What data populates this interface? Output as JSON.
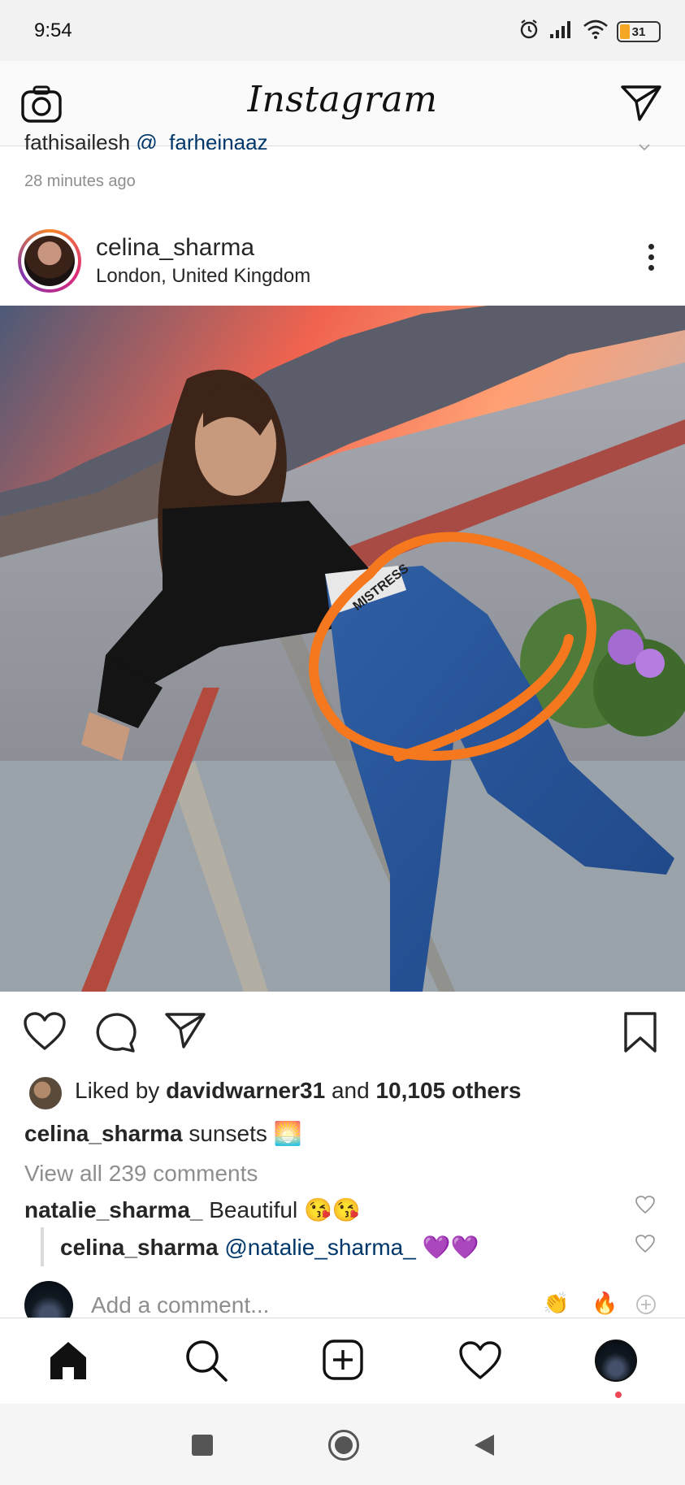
{
  "status_bar": {
    "time": "9:54",
    "battery": "31"
  },
  "header": {
    "logo": "Instagram",
    "camera_icon": "camera-icon",
    "direct_icon": "paper-plane-icon"
  },
  "previous": {
    "cutoff_user": "fathisailesh",
    "cutoff_mention": "@_farheinaaz_",
    "time_ago": "28 minutes ago"
  },
  "post": {
    "username": "celina_sharma",
    "location": "London, United Kingdom",
    "likes": {
      "prefix": "Liked by",
      "user": "davidwarner31",
      "conj": "and",
      "others": "10,105 others"
    },
    "caption": {
      "user": "celina_sharma",
      "text": "sunsets",
      "emoji": "🌅"
    },
    "view_all": "View all 239 comments",
    "comments": [
      {
        "user": "natalie_sharma_",
        "text": "Beautiful",
        "emoji": "😘😘"
      },
      {
        "user": "celina_sharma",
        "mention": "@natalie_sharma_",
        "emoji": "💜💜"
      }
    ],
    "photo_text": "MISTRESS"
  },
  "add_comment": {
    "placeholder": "Add a comment...",
    "quick_emojis": [
      "👏",
      "🔥"
    ]
  },
  "colors": {
    "accent_orange": "#f5781e",
    "link": "#00376b",
    "muted": "#8e8e8e",
    "notification": "#ed4956"
  }
}
